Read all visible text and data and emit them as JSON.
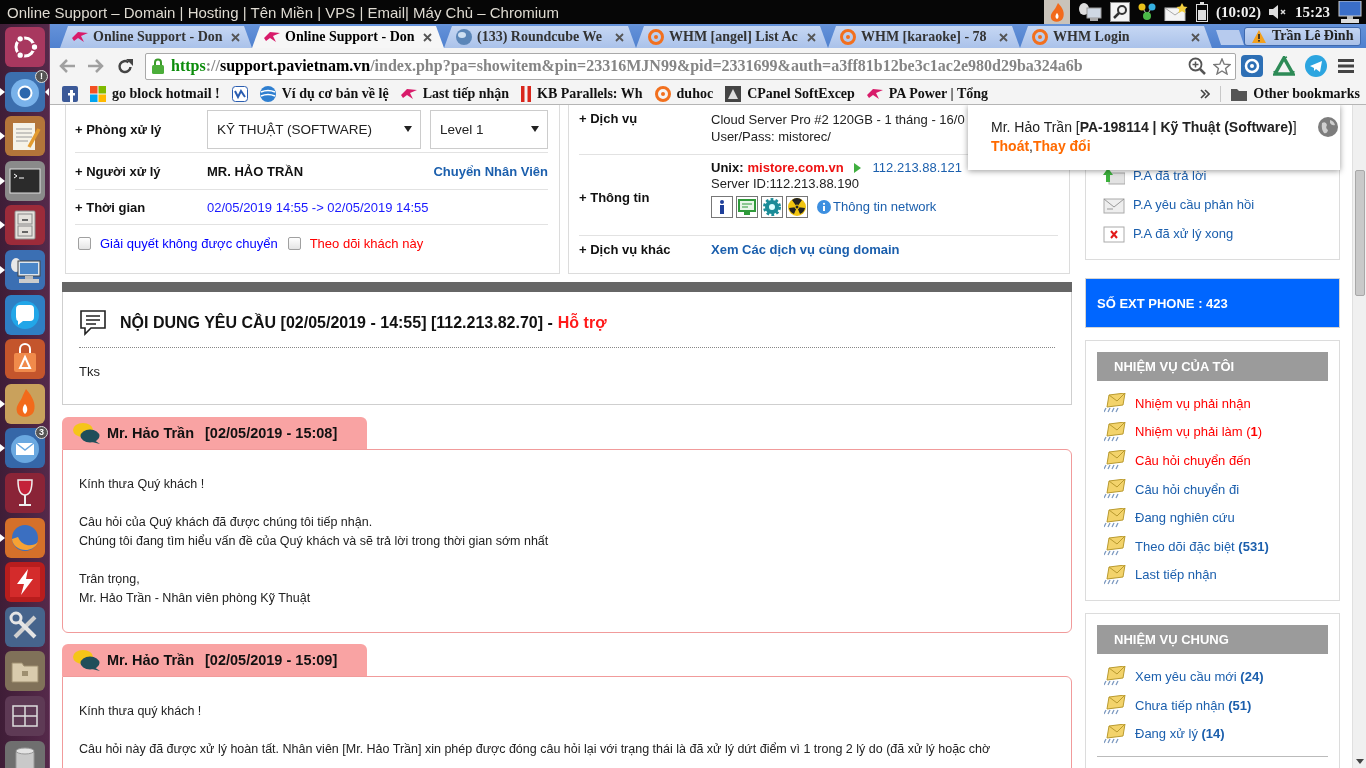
{
  "top_panel": {
    "title": "Online Support – Domain | Hosting | Tên Miền | VPS | Email| Máy Chủ – Chromium",
    "battery_time": "(10:02)",
    "clock": "15:23"
  },
  "launcher": [
    {
      "kind": "ring-logo",
      "running": false,
      "focused": false
    },
    {
      "kind": "sphere",
      "running": true,
      "focused": true,
      "badge": "!"
    },
    {
      "kind": "notepad",
      "running": true,
      "focused": false
    },
    {
      "kind": "terminal",
      "running": true,
      "focused": false
    },
    {
      "kind": "cabinet",
      "running": true,
      "focused": false
    },
    {
      "kind": "remote-desktop",
      "running": true,
      "focused": false
    },
    {
      "kind": "chat",
      "running": false,
      "focused": false
    },
    {
      "kind": "store",
      "running": false,
      "focused": false
    },
    {
      "kind": "flame",
      "running": true,
      "focused": false
    },
    {
      "kind": "mail",
      "running": true,
      "focused": false,
      "badge": "3"
    },
    {
      "kind": "wine",
      "running": false,
      "focused": false
    },
    {
      "kind": "fox",
      "running": true,
      "focused": false
    },
    {
      "kind": "ftp",
      "running": false,
      "focused": false
    },
    {
      "kind": "tools",
      "running": false,
      "focused": false
    },
    {
      "kind": "folder",
      "running": false,
      "focused": false
    },
    {
      "kind": "workspaces",
      "running": false,
      "focused": false
    },
    {
      "kind": "trash",
      "running": false,
      "focused": false
    }
  ],
  "tabs": [
    {
      "kind": "pa",
      "title": "Online Support - Don",
      "selected": false
    },
    {
      "kind": "pa",
      "title": "Online Support - Don",
      "selected": true
    },
    {
      "kind": "sphere",
      "title": "(133) Roundcube We",
      "selected": false
    },
    {
      "kind": "cp",
      "title": "WHM [angel] List Ac",
      "selected": false
    },
    {
      "kind": "cp",
      "title": "WHM [karaoke] - 78",
      "selected": false
    },
    {
      "kind": "cp",
      "title": "WHM Login",
      "selected": false
    }
  ],
  "profile": {
    "name": "Trần Lê Đình"
  },
  "address_bar": {
    "scheme": "https",
    "separator": "://",
    "host": "support.pavietnam.vn",
    "path": "/index.php?pa=showitem&pin=23316MJN99&pid=2331699&auth=a3ff81b12be3c1ac2e980d29ba324a6b"
  },
  "bookmarks": [
    {
      "kind": "fb"
    },
    {
      "kind": "tiles",
      "label": "go block hotmail !"
    },
    {
      "kind": "zed"
    },
    {
      "kind": "globe",
      "label": "Ví dụ cơ bản về lệ"
    },
    {
      "kind": "pa",
      "label": "Last tiếp nhận"
    },
    {
      "kind": "bars",
      "label": "KB Parallels: Wh"
    },
    {
      "kind": "cp",
      "label": "duhoc"
    },
    {
      "kind": "fa",
      "label": "CPanel SoftExcep"
    },
    {
      "kind": "pa",
      "label": "PA Power | Tổng"
    }
  ],
  "other_bookmarks": "Other bookmarks",
  "assignment": {
    "department_label": "+ Phòng xử lý",
    "department": "KỸ THUẬT (SOFTWARE)",
    "tier": "Level 1",
    "handler_label": "+ Người xử lý",
    "handler": "MR. HẢO TRẦN",
    "transfer_link": "Chuyển Nhân Viên",
    "time_label": "+ Thời gian",
    "time_range": "02/05/2019 14:55 -> 02/05/2019 14:55",
    "options": [
      {
        "label": "Giải quyết không được chuyển",
        "checked": false,
        "color": "#0000ff"
      },
      {
        "label": "Theo dõi khách này",
        "checked": false,
        "color": "#ff0000"
      }
    ]
  },
  "service": {
    "service_label": "+ Dịch vụ",
    "service_lines": [
      "Cloud Server Pro #2 120GB - 1 tháng - 16/0",
      "User/Pass: mistorec/"
    ],
    "info_label": "+ Thông tin",
    "os": "Unix:",
    "domain": "mistore.com.vn",
    "ip": "112.213.88.121",
    "server_id": "Server ID:112.213.88.190",
    "tools": [
      {
        "kind": "info"
      },
      {
        "kind": "screen"
      },
      {
        "kind": "gear"
      },
      {
        "kind": "radiation"
      }
    ],
    "network_link": "Thông tin network",
    "other_label": "+ Dịch vụ khác",
    "other_link": "Xem Các dịch vụ cùng domain"
  },
  "request": {
    "title": "NỘI DUNG YÊU CẦU [02/05/2019 - 14:55] [112.213.82.70] -",
    "type": "Hỗ trợ",
    "body": "Tks"
  },
  "replies": [
    {
      "author": "Mr. Hảo Trần",
      "date": "[02/05/2019 - 15:08]",
      "paragraphs": [
        "Kính thưa Quý khách !",
        "Câu hỏi của Quý khách đã được chúng tôi tiếp nhận.\nChúng tôi đang tìm hiểu vấn đề của Quý khách và sẽ trả lời trong thời gian sớm nhất",
        "Trân trọng,\nMr. Hảo Trần - Nhân viên phòng Kỹ Thuật"
      ]
    },
    {
      "author": "Mr. Hảo Trần",
      "date": "[02/05/2019 - 15:09]",
      "paragraphs": [
        "Kính thưa quý khách !",
        "Câu hỏi này đã được xử lý hoàn tất. Nhân viên [Mr. Hảo Trần] xin phép được đóng câu hỏi lại với trạng thái là đã xử lý dứt điểm vì 1 trong 2 lý do (đã xử lý hoặc chờ"
      ]
    }
  ],
  "status_links": [
    {
      "kind": "replied",
      "label": "P.A đã trả lời"
    },
    {
      "kind": "awaiting",
      "label": "P.A yêu cầu phản hồi"
    },
    {
      "kind": "done",
      "label": "P.A đã xử lý xong"
    }
  ],
  "ext_phone": "SỐ EXT PHONE : 423",
  "task_groups": [
    {
      "title": "NHIỆM VỤ CỦA TÔI",
      "items": [
        {
          "label": "Nhiệm vụ phải nhận",
          "highlighted": true
        },
        {
          "label": "Nhiệm vụ phải làm (**1**)",
          "highlighted": true
        },
        {
          "label": "Câu hỏi chuyển đến",
          "highlighted": true
        },
        {
          "label": "Câu hỏi chuyển đi",
          "highlighted": false
        },
        {
          "label": "Đang nghiên cứu",
          "highlighted": false
        },
        {
          "label": "Theo dõi đặc biệt **(531)**",
          "highlighted": false
        },
        {
          "label": "Last tiếp nhận",
          "highlighted": false
        }
      ]
    },
    {
      "title": "NHIỆM VỤ CHUNG",
      "items": [
        {
          "label": "Xem yêu cầu mới **(24)**",
          "highlighted": false
        },
        {
          "label": "Chưa tiếp nhận **(51)**",
          "highlighted": false
        },
        {
          "label": "Đang xử lý **(14)**",
          "highlighted": false
        }
      ]
    }
  ],
  "account_popup": {
    "user": "Mr. Hảo Trần [**PA-198114 | Kỹ Thuật (Software)**]",
    "links": [
      "Thoát",
      "Thay đổi"
    ],
    "separator": ","
  }
}
